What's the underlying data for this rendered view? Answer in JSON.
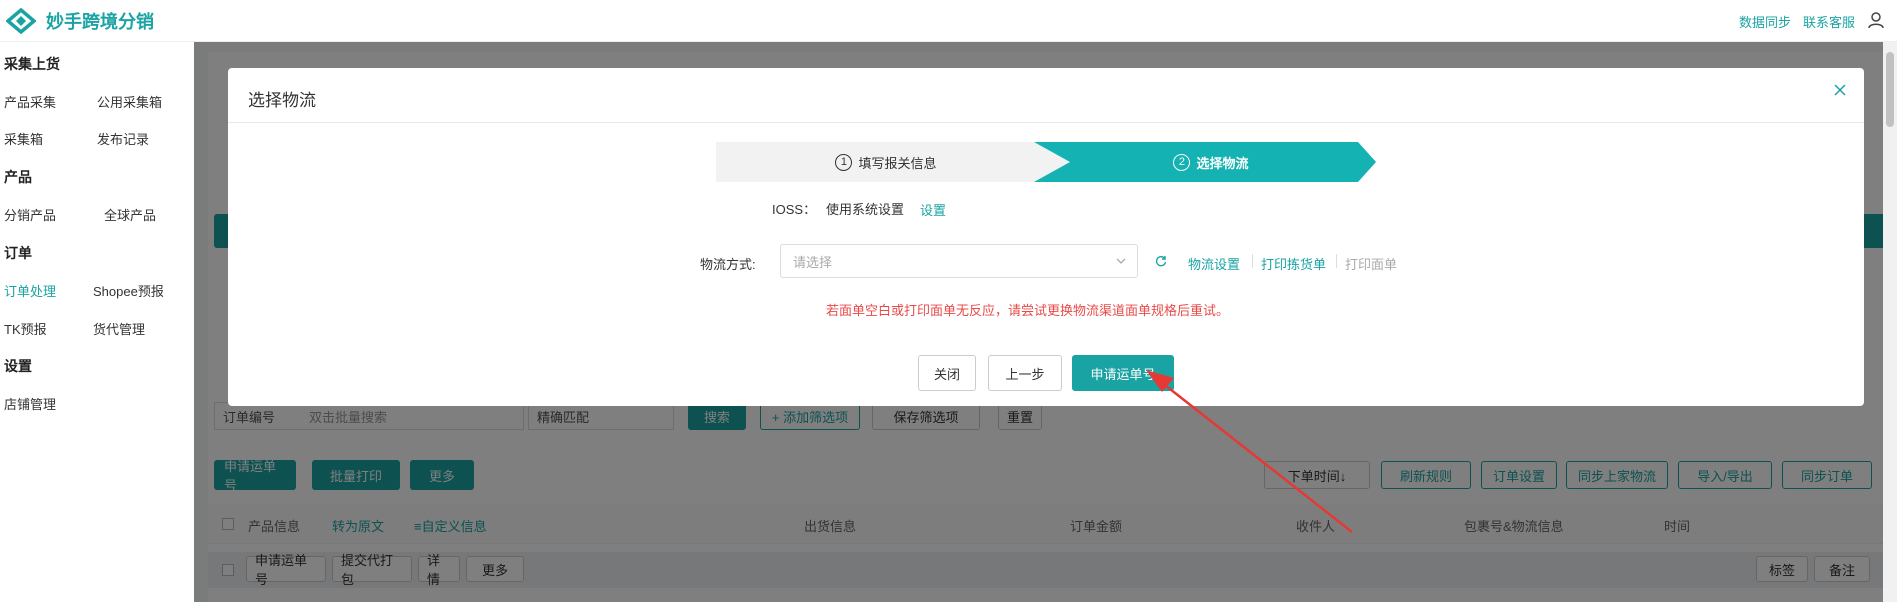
{
  "app": {
    "title": "妙手跨境分销"
  },
  "header": {
    "links": [
      "数据同步",
      "联系客服"
    ]
  },
  "sidebar": {
    "sections": [
      {
        "title": "采集上货",
        "items": [
          "产品采集",
          "公用采集箱",
          "采集箱",
          "发布记录"
        ]
      },
      {
        "title": "产品",
        "items": [
          "分销产品",
          "全球产品"
        ]
      },
      {
        "title": "订单",
        "items": [
          "订单处理",
          "Shopee预报",
          "TK预报",
          "货代管理"
        ]
      },
      {
        "title": "设置",
        "items": [
          "店铺管理"
        ]
      }
    ],
    "active_item": "订单处理"
  },
  "background": {
    "filter": {
      "order_no_label": "订单编号",
      "search_placeholder": "双击批量搜索",
      "match_mode": "精确匹配",
      "search_button": "搜索",
      "add_filter": "+ 添加筛选项",
      "save_filter": "保存筛选项",
      "reset": "重置"
    },
    "toolbar": {
      "apply_tracking": "申请运单号",
      "batch_print": "批量打印",
      "more": "更多",
      "sort": "下单时间↓",
      "refresh_rules": "刷新规则",
      "order_settings": "订单设置",
      "sync_logistics": "同步上家物流",
      "import_export": "导入/导出",
      "sync_orders": "同步订单"
    },
    "table_headers": {
      "product_info": "产品信息",
      "translate": "转为原文",
      "custom_info": "≡自定义信息",
      "shipping_info": "出货信息",
      "order_amount": "订单金额",
      "receiver": "收件人",
      "package_logistics": "包裹号&物流信息",
      "time": "时间"
    },
    "row_actions": {
      "apply_tracking": "申请运单号",
      "submit_packing": "提交代打包",
      "detail": "详情",
      "more": "更多",
      "tag": "标签",
      "note": "备注"
    }
  },
  "modal": {
    "title": "选择物流",
    "steps": [
      {
        "num": "1",
        "label": "填写报关信息",
        "active": false
      },
      {
        "num": "2",
        "label": "选择物流",
        "active": true
      }
    ],
    "ioss": {
      "label": "IOSS：",
      "value": "使用系统设置",
      "link": "设置"
    },
    "logistics": {
      "label": "物流方式:",
      "placeholder": "请选择",
      "settings_link": "物流设置",
      "print_picking": "打印拣货单",
      "print_label": "打印面单"
    },
    "warning": "若面单空白或打印面单无反应，请尝试更换物流渠道面单规格后重试。",
    "buttons": {
      "close": "关闭",
      "prev": "上一步",
      "apply": "申请运单号"
    }
  },
  "colors": {
    "accent": "#1aa3a3",
    "warning": "#e84a4a",
    "annotation_arrow": "#e53935"
  }
}
